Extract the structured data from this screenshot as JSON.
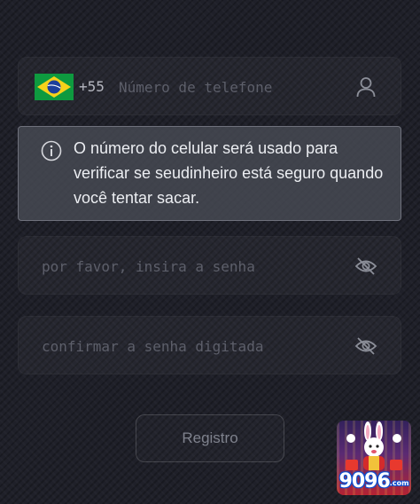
{
  "phone": {
    "country_code": "+55",
    "flag_icon": "brazil-flag-icon",
    "value": "",
    "placeholder": "Número de telefone"
  },
  "tooltip": {
    "text": "O número do celular será usado para verificar se seudinheiro está seguro quando você tentar sacar."
  },
  "password": {
    "value": "",
    "placeholder": "por favor, insira a senha"
  },
  "confirm_password": {
    "value": "",
    "placeholder": "confirmar a senha digitada"
  },
  "register_button": {
    "label": "Registro"
  },
  "promo": {
    "logo_text": "9096",
    "logo_domain": ".com"
  },
  "colors": {
    "background": "#1f2029",
    "field_bg": "#272832",
    "tooltip_bg": "#4e505a",
    "text_muted": "#5d5f6a"
  }
}
